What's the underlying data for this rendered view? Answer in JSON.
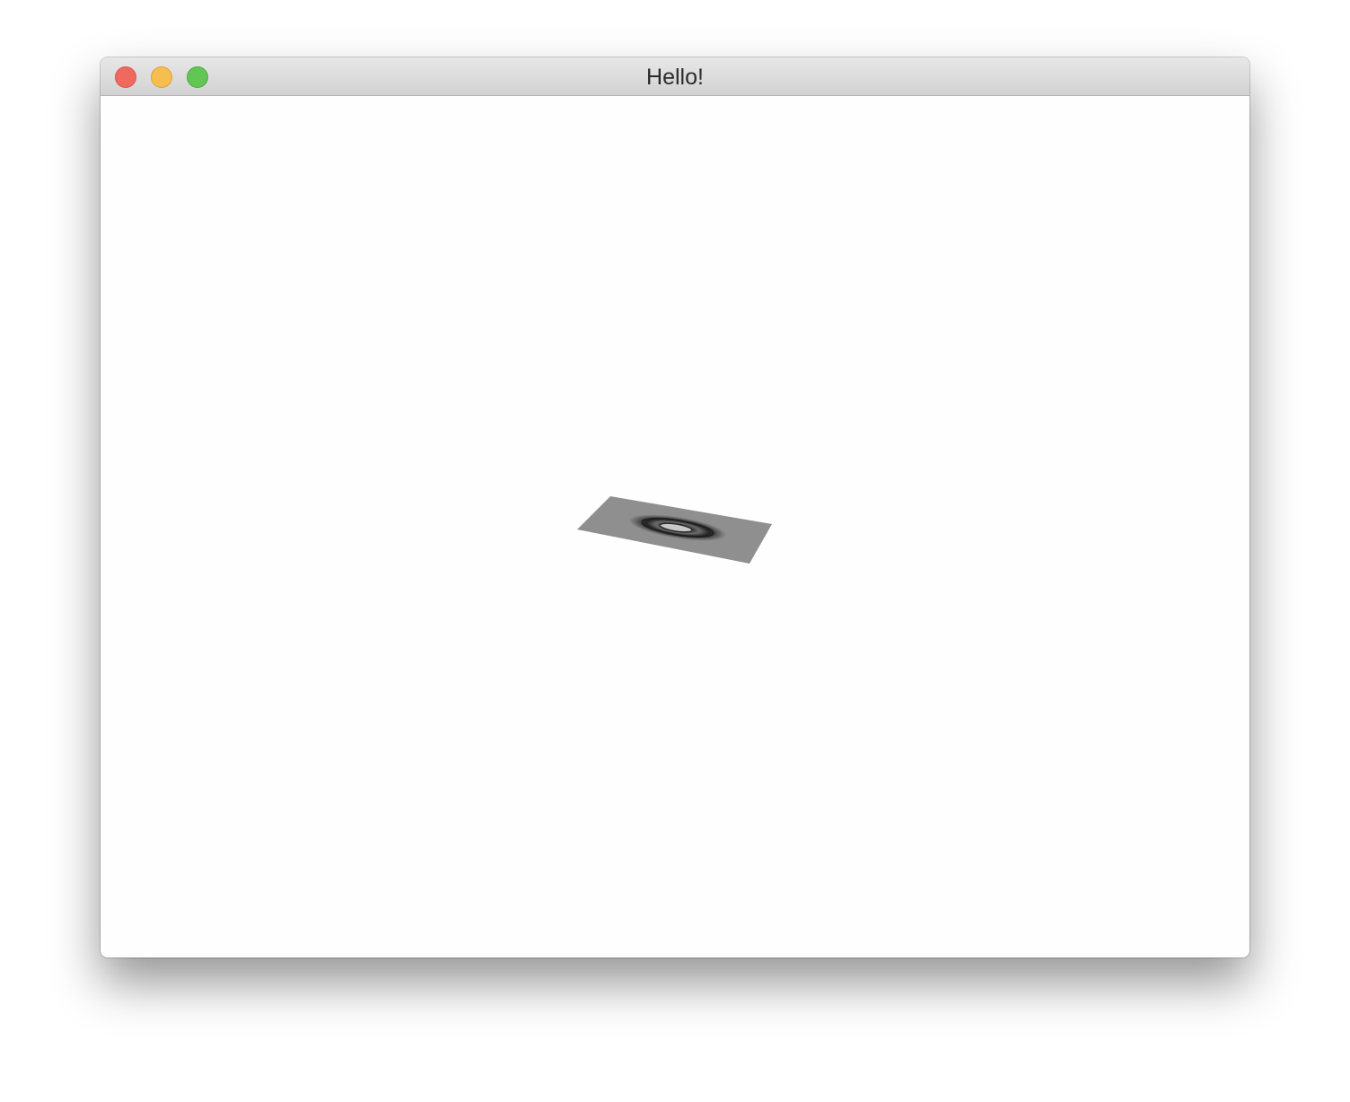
{
  "window": {
    "title": "Hello!",
    "controls": {
      "close": "close-button",
      "minimize": "minimize-button",
      "zoom": "zoom-button"
    }
  },
  "colors": {
    "close": "#ee6a5f",
    "minimize": "#f5be4f",
    "zoom": "#62c655",
    "surface_plane": "#8f8f8f",
    "background": "#fefefe"
  },
  "viewport": {
    "content": "3d-surface-plot"
  }
}
